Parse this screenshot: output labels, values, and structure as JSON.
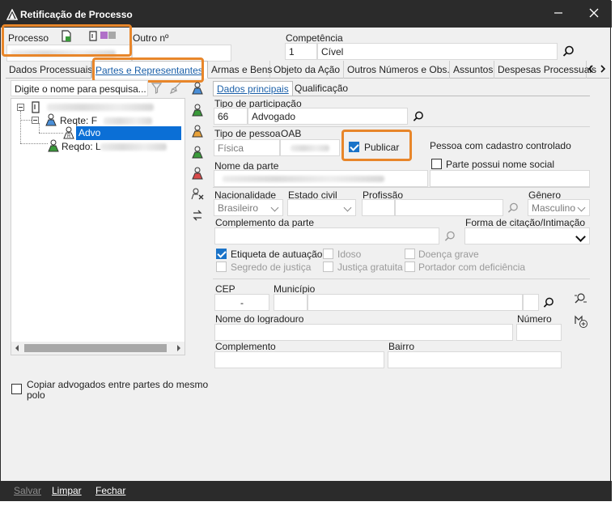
{
  "window": {
    "title": "Retificação de Processo"
  },
  "header": {
    "processo_label": "Processo",
    "outro_label": "Outro nº",
    "competencia_label": "Competência",
    "competencia_code": "1",
    "competencia_value": "Cível"
  },
  "tabs": [
    {
      "label": "Dados Processuais"
    },
    {
      "label": "Partes e Representantes"
    },
    {
      "label": "Armas e Bens"
    },
    {
      "label": "Objeto da Ação"
    },
    {
      "label": "Outros Números e Obs."
    },
    {
      "label": "Assuntos"
    },
    {
      "label": "Despesas Processuais"
    }
  ],
  "left_panel": {
    "search_placeholder": "Digite o nome para pesquisa...",
    "tree": {
      "reqte_label": "Reqte: F",
      "advo_label": "Advo",
      "reqdo_label": "Reqdo: L"
    },
    "copy_checkbox_label": "Copiar advogados entre partes do mesmo polo"
  },
  "subtabs": [
    {
      "label": "Dados principais"
    },
    {
      "label": "Qualificação"
    }
  ],
  "form": {
    "tipo_participacao_label": "Tipo de participação",
    "tipo_participacao_code": "66",
    "tipo_participacao_value": "Advogado",
    "tipo_pessoa_label": "Tipo de pessoa",
    "tipo_pessoa_value": "Física",
    "oab_label": "OAB",
    "publicar_label": "Publicar",
    "pessoa_controlado_label": "Pessoa com cadastro controlado",
    "nome_parte_label": "Nome da parte",
    "nome_social_label": "Parte possui nome social",
    "nacionalidade_label": "Nacionalidade",
    "nacionalidade_value": "Brasileiro",
    "estado_civil_label": "Estado civil",
    "profissao_label": "Profissão",
    "genero_label": "Gênero",
    "genero_value": "Masculino",
    "complemento_parte_label": "Complemento da parte",
    "forma_citacao_label": "Forma de citação/Intimação",
    "etiqueta_label": "Etiqueta de autuação",
    "idoso_label": "Idoso",
    "doenca_label": "Doença grave",
    "segredo_label": "Segredo de justiça",
    "justica_gratuita_label": "Justiça gratuita",
    "portador_label": "Portador com deficiência",
    "cep_label": "CEP",
    "cep_value": "-",
    "municipio_label": "Município",
    "logradouro_label": "Nome do logradouro",
    "numero_label": "Número",
    "complemento_label": "Complemento",
    "bairro_label": "Bairro"
  },
  "footer": {
    "salvar": "Salvar",
    "limpar": "Limpar",
    "fechar": "Fechar"
  },
  "colors": {
    "accent": "#1a73c8",
    "highlight": "#e8862a",
    "titlebar": "#2b2b2b",
    "selection": "#0b6fd6"
  }
}
